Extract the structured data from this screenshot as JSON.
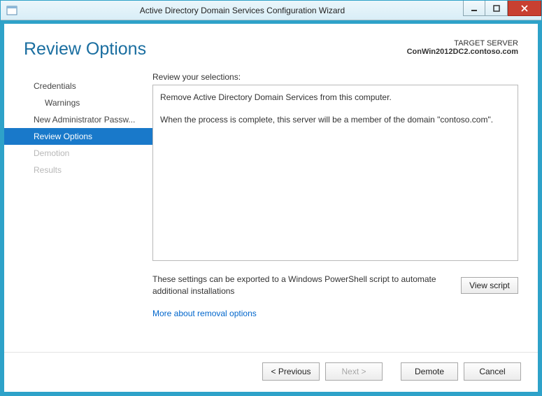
{
  "titlebar": {
    "title": "Active Directory Domain Services Configuration Wizard"
  },
  "header": {
    "page_title": "Review Options",
    "target_label": "TARGET SERVER",
    "target_name": "ConWin2012DC2.contoso.com"
  },
  "sidebar": {
    "items": [
      {
        "label": "Credentials"
      },
      {
        "label": "Warnings"
      },
      {
        "label": "New Administrator Passw..."
      },
      {
        "label": "Review Options"
      },
      {
        "label": "Demotion"
      },
      {
        "label": "Results"
      }
    ]
  },
  "main": {
    "section_label": "Review your selections:",
    "review_line1": "Remove Active Directory Domain Services from this computer.",
    "review_line2": "When the process is complete, this server will be a member of the domain \"contoso.com\".",
    "export_text": "These settings can be exported to a Windows PowerShell script to automate additional installations",
    "view_script": "View script",
    "more_link": "More about removal options"
  },
  "footer": {
    "previous": "< Previous",
    "next": "Next >",
    "demote": "Demote",
    "cancel": "Cancel"
  }
}
